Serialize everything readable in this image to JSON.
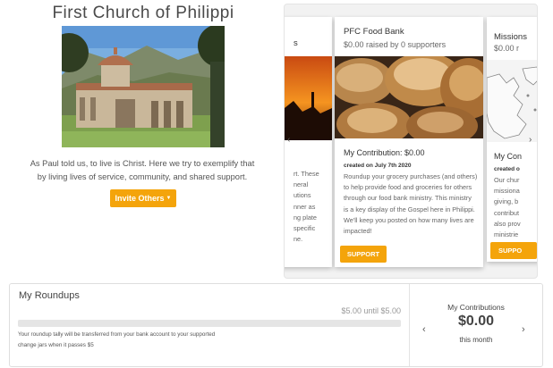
{
  "church": {
    "title": "First Church of Philippi",
    "description": "As Paul told us, to live is Christ. Here we try to exemplify that by living lives of service, community, and shared support.",
    "invite_label": "Invite Others"
  },
  "carousel": {
    "left_card": {
      "title": "s",
      "body": "rt. These\nneral\nutions\nnner as\nng plate\nspecific\nne."
    },
    "main_card": {
      "title": "PFC Food Bank",
      "raised": "$0.00 raised by 0 supporters",
      "contribution": "My Contribution: $0.00",
      "created": "created on July 7th 2020",
      "body": "Roundup your grocery purchases (and others) to help provide food and groceries for others through our food bank ministry. This ministry is a key display of the Gospel here in Philippi. We'll keep you posted on how many lives are impacted!",
      "support_label": "SUPPORT"
    },
    "right_card": {
      "title": "Missions",
      "raised": "$0.00 r",
      "contribution": "My Con",
      "created": "created o",
      "body": "Our chur\nmissiona\ngiving, b\ncontribut\nalso prov\nministrie",
      "support_label": "SUPPO"
    },
    "prev_icon": "‹",
    "next_icon": "›"
  },
  "roundups": {
    "title": "My Roundups",
    "amount": "$5.00 until $5.00",
    "progress": 0,
    "note": "Your roundup tally will be transferred from your bank account to your supported change jars when it passes $5"
  },
  "contributions": {
    "title": "My Contributions",
    "value": "$0.00",
    "period": "this month",
    "prev_icon": "‹",
    "next_icon": "›"
  },
  "colors": {
    "accent": "#f4a40b"
  }
}
